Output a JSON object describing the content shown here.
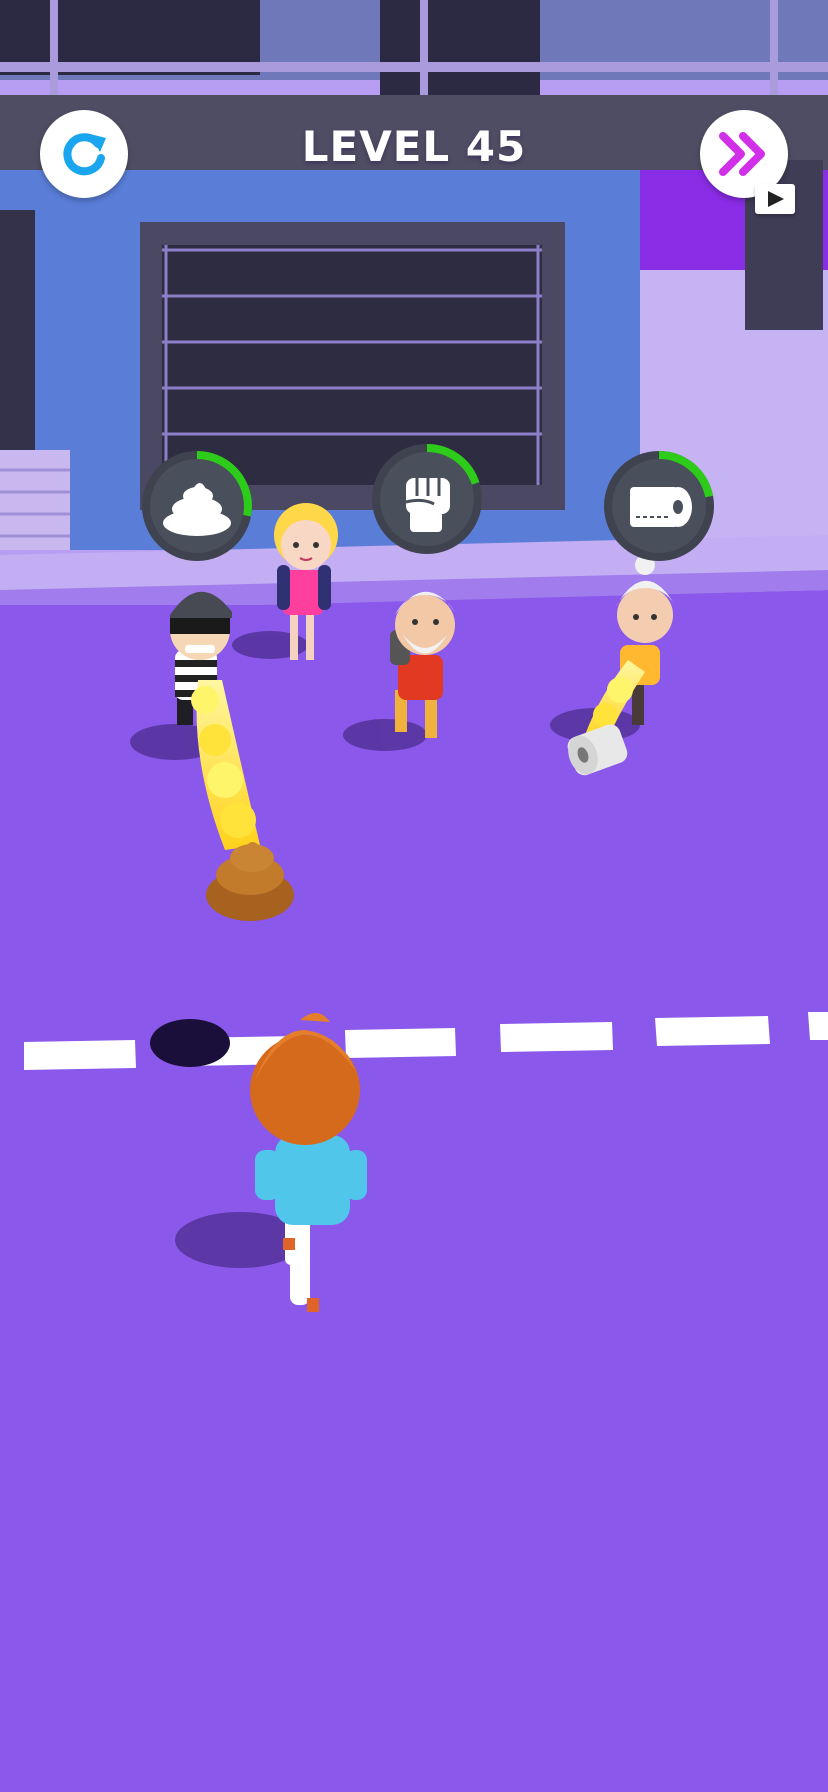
{
  "hud": {
    "level_label": "LEVEL 45",
    "restart_icon": "restart-icon",
    "skip_icon": "double-chevron-right-icon",
    "video_badge_icon": "play-video-icon"
  },
  "item_choices": [
    {
      "icon": "poop-icon",
      "progress": 0.28
    },
    {
      "icon": "fist-icon",
      "progress": 0.2
    },
    {
      "icon": "toilet-paper-icon",
      "progress": 0.22
    }
  ],
  "colors": {
    "ground": "#8a58ea",
    "accent_blue": "#1aa6ee",
    "accent_magenta": "#d130e8",
    "progress_green": "#2ecc1a",
    "badge_fill": "#4a4f5c"
  }
}
